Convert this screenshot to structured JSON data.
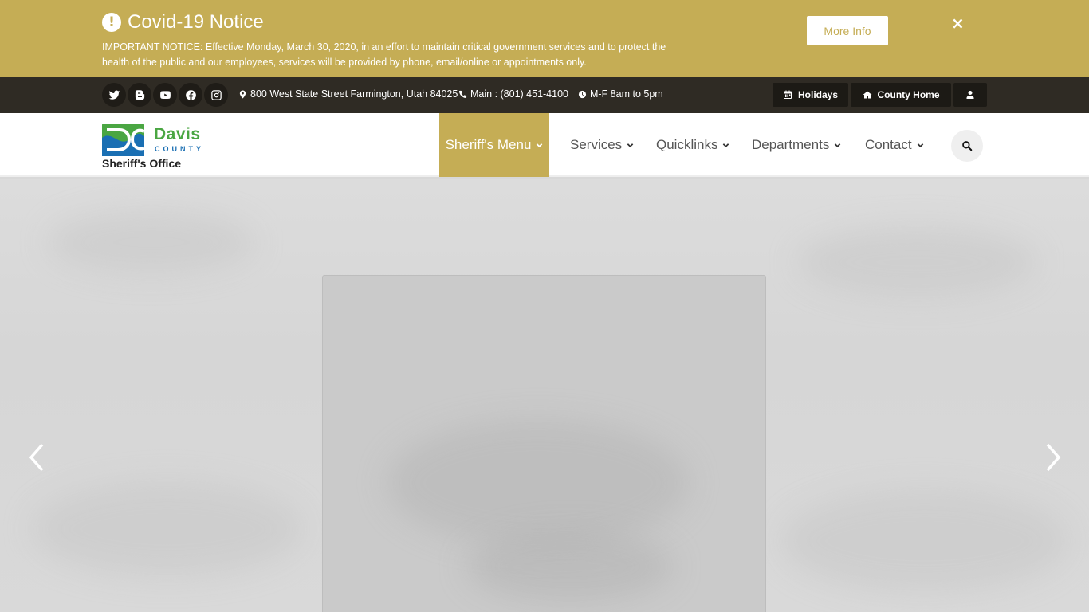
{
  "notice": {
    "title": "Covid-19 Notice",
    "alert_symbol": "!",
    "text": "IMPORTANT NOTICE: Effective Monday, March 30, 2020, in an effort to maintain critical government services and to protect the health of the public and our employees, services will be provided by phone, email/online or appointments only.",
    "more_info_label": "More Info",
    "close_symbol": "×"
  },
  "topbar": {
    "socials": [
      "twitter-icon",
      "blogger-icon",
      "youtube-icon",
      "facebook-icon",
      "instagram-icon"
    ],
    "address": "800 West State Street Farmington, Utah 84025",
    "phone": "Main : (801) 451-4100",
    "hours": "M-F 8am to 5pm",
    "holidays_label": "Holidays",
    "county_home_label": "County Home"
  },
  "logo": {
    "name": "Davis",
    "county": "COUNTY",
    "subtitle": "Sheriff's Office"
  },
  "nav": {
    "items": [
      {
        "label": "Sheriff's Menu",
        "active": true
      },
      {
        "label": "Services",
        "active": false
      },
      {
        "label": "Quicklinks",
        "active": false
      },
      {
        "label": "Departments",
        "active": false
      },
      {
        "label": "Contact",
        "active": false
      }
    ]
  },
  "colors": {
    "gold": "#c5ad55",
    "dark_bar": "#2f2b24",
    "logo_green": "#4aa642",
    "logo_blue": "#1a6fb3"
  }
}
